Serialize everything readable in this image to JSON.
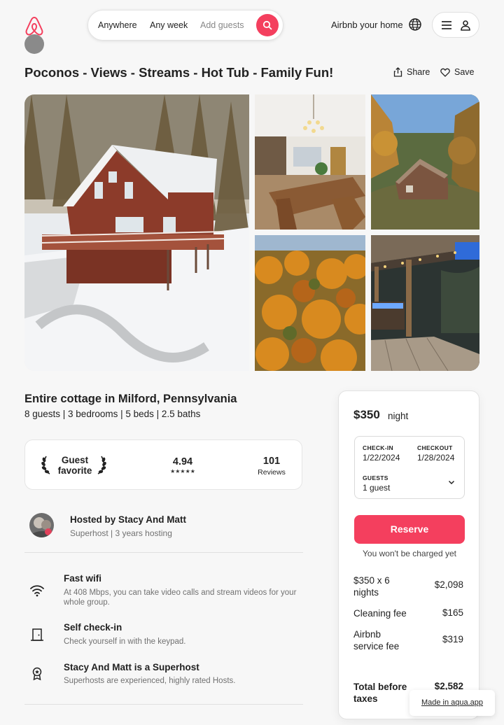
{
  "header": {
    "search": {
      "location": "Anywhere",
      "week": "Any week",
      "guests_placeholder": "Add guests"
    },
    "host_link": "Airbnb your home"
  },
  "listing": {
    "title": "Poconos - Views - Streams - Hot Tub - Family Fun!",
    "share_label": "Share",
    "save_label": "Save",
    "property_type": "Entire cottage in Milford, Pennsylvania",
    "details": "8 guests | 3 bedrooms | 5 beds | 2.5 baths"
  },
  "guest_favorite": {
    "label_line1": "Guest",
    "label_line2": "favorite",
    "rating": "4.94",
    "stars": "★★★★★",
    "reviews_count": "101",
    "reviews_label": "Reviews"
  },
  "host": {
    "hosted_by": "Hosted by Stacy And Matt",
    "meta": "Superhost | 3 years hosting"
  },
  "amenities": [
    {
      "icon": "wifi-icon",
      "title": "Fast wifi",
      "desc": "At 408 Mbps, you can take video calls and stream videos for your whole group."
    },
    {
      "icon": "door-icon",
      "title": "Self check-in",
      "desc": "Check yourself in with the keypad."
    },
    {
      "icon": "medal-icon",
      "title": "Stacy And Matt is a Superhost",
      "desc": "Superhosts are experienced, highly rated Hosts."
    }
  ],
  "booking": {
    "price": "$350",
    "per_night": "night",
    "checkin_label": "CHECK-IN",
    "checkin_value": "1/22/2024",
    "checkout_label": "CHECKOUT",
    "checkout_value": "1/28/2024",
    "guests_label": "GUESTS",
    "guests_value": "1 guest",
    "reserve_label": "Reserve",
    "no_charge_note": "You won't be charged yet",
    "fees": [
      {
        "label_line1": "$350 x 6",
        "label_line2": "nights",
        "value": "$2,098"
      },
      {
        "label_line1": "Cleaning fee",
        "label_line2": "",
        "value": "$165"
      },
      {
        "label_line1": "Airbnb",
        "label_line2": "service fee",
        "value": "$319"
      }
    ],
    "total_label_line1": "Total before",
    "total_label_line2": "taxes",
    "total_value": "$2,582"
  },
  "badge": "Made in aqua.app",
  "colors": {
    "accent": "#f43f5e",
    "text": "#222222",
    "muted": "#717171"
  }
}
